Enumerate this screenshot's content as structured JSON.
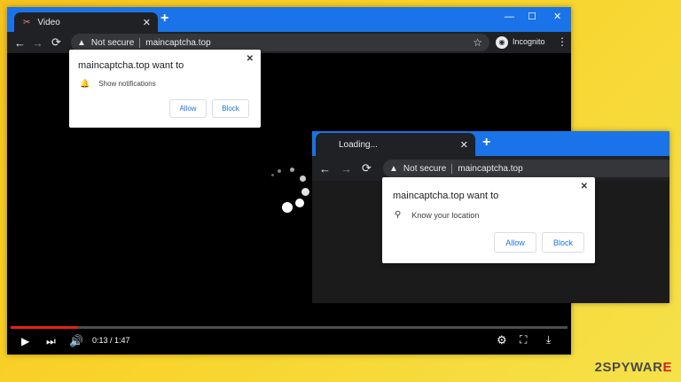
{
  "main_window": {
    "tab_title": "Video",
    "tab_close": "✕",
    "new_tab": "+",
    "window_controls": {
      "minimize": "—",
      "maximize": "☐",
      "close": "✕"
    },
    "security_label": "Not secure",
    "url": "maincaptcha.top",
    "profile_label": "Incognito",
    "prompt": {
      "title": "maincaptcha.top want to",
      "permission": "Show notifications",
      "allow": "Allow",
      "block": "Block",
      "close": "✕"
    },
    "player": {
      "time": "0:13 / 1:47",
      "progress": 0.121
    }
  },
  "second_window": {
    "tab_title": "Loading...",
    "tab_close": "✕",
    "new_tab": "+",
    "security_label": "Not secure",
    "url": "maincaptcha.top",
    "prompt": {
      "title": "maincaptcha.top want to",
      "permission": "Know your location",
      "allow": "Allow",
      "block": "Block",
      "close": "✕"
    }
  },
  "watermark": {
    "prefix": "2SPYWAR",
    "accent": "E"
  },
  "colors": {
    "titlebar": "#1a73e8",
    "toolbar": "#202124",
    "progress": "#e62117",
    "link": "#1a73e8"
  }
}
